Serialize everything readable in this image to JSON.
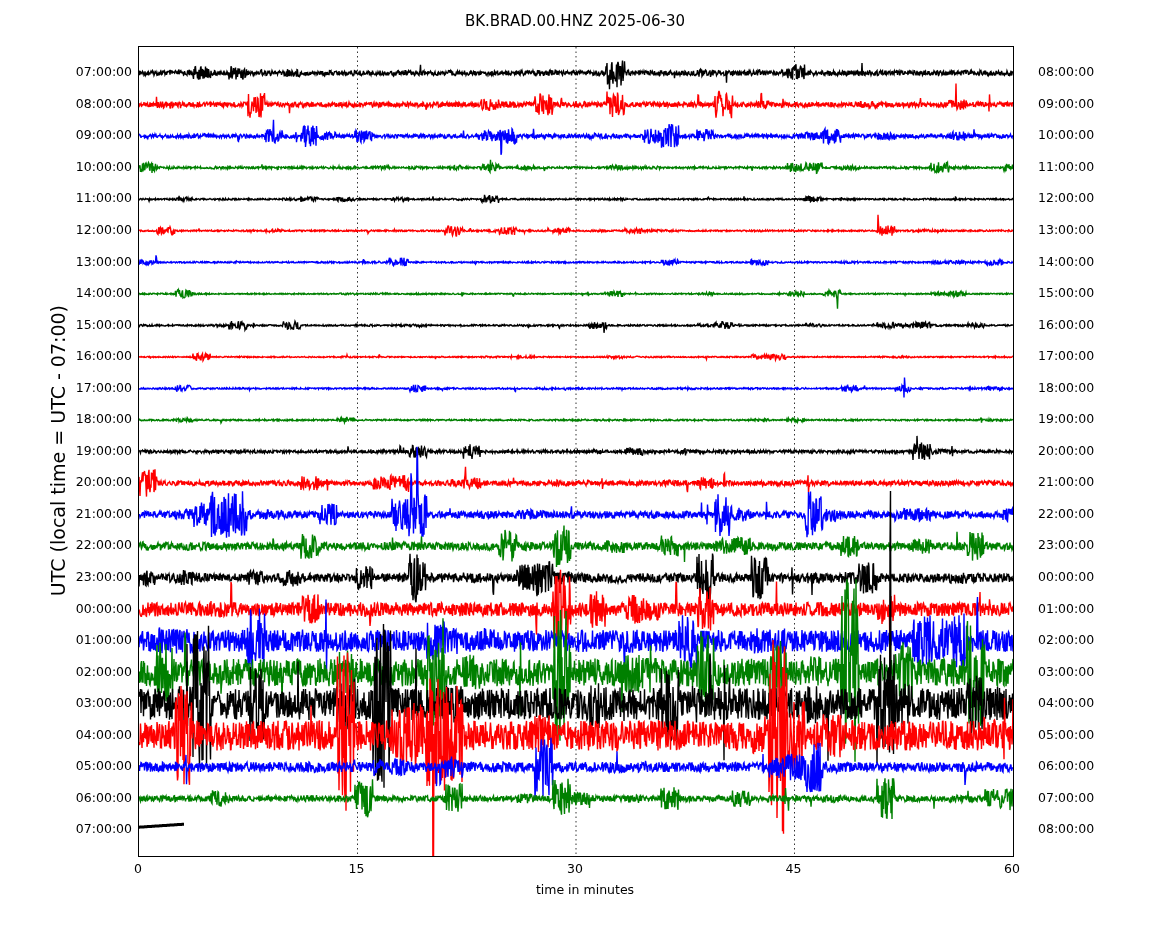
{
  "title": "BK.BRAD.00.HNZ 2025-06-30",
  "y_axis_label": "UTC (local time = UTC - 07:00)",
  "x_axis": {
    "label": "time in minutes",
    "ticks": [
      "0",
      "15",
      "30",
      "45",
      "60"
    ]
  },
  "rows": [
    {
      "left": "07:00:00",
      "right": "08:00:00",
      "color": "#000000"
    },
    {
      "left": "08:00:00",
      "right": "09:00:00",
      "color": "#ff0000"
    },
    {
      "left": "09:00:00",
      "right": "10:00:00",
      "color": "#0000ff"
    },
    {
      "left": "10:00:00",
      "right": "11:00:00",
      "color": "#008000"
    },
    {
      "left": "11:00:00",
      "right": "12:00:00",
      "color": "#000000"
    },
    {
      "left": "12:00:00",
      "right": "13:00:00",
      "color": "#ff0000"
    },
    {
      "left": "13:00:00",
      "right": "14:00:00",
      "color": "#0000ff"
    },
    {
      "left": "14:00:00",
      "right": "15:00:00",
      "color": "#008000"
    },
    {
      "left": "15:00:00",
      "right": "16:00:00",
      "color": "#000000"
    },
    {
      "left": "16:00:00",
      "right": "17:00:00",
      "color": "#ff0000"
    },
    {
      "left": "17:00:00",
      "right": "18:00:00",
      "color": "#0000ff"
    },
    {
      "left": "18:00:00",
      "right": "19:00:00",
      "color": "#008000"
    },
    {
      "left": "19:00:00",
      "right": "20:00:00",
      "color": "#000000"
    },
    {
      "left": "20:00:00",
      "right": "21:00:00",
      "color": "#ff0000"
    },
    {
      "left": "21:00:00",
      "right": "22:00:00",
      "color": "#0000ff"
    },
    {
      "left": "22:00:00",
      "right": "23:00:00",
      "color": "#008000"
    },
    {
      "left": "23:00:00",
      "right": "00:00:00",
      "color": "#000000"
    },
    {
      "left": "00:00:00",
      "right": "01:00:00",
      "color": "#ff0000"
    },
    {
      "left": "01:00:00",
      "right": "02:00:00",
      "color": "#0000ff"
    },
    {
      "left": "02:00:00",
      "right": "03:00:00",
      "color": "#008000"
    },
    {
      "left": "03:00:00",
      "right": "04:00:00",
      "color": "#000000"
    },
    {
      "left": "04:00:00",
      "right": "05:00:00",
      "color": "#ff0000"
    },
    {
      "left": "05:00:00",
      "right": "06:00:00",
      "color": "#0000ff"
    },
    {
      "left": "06:00:00",
      "right": "07:00:00",
      "color": "#008000"
    },
    {
      "left": "07:00:00",
      "right": "08:00:00",
      "color": "#000000"
    }
  ]
}
